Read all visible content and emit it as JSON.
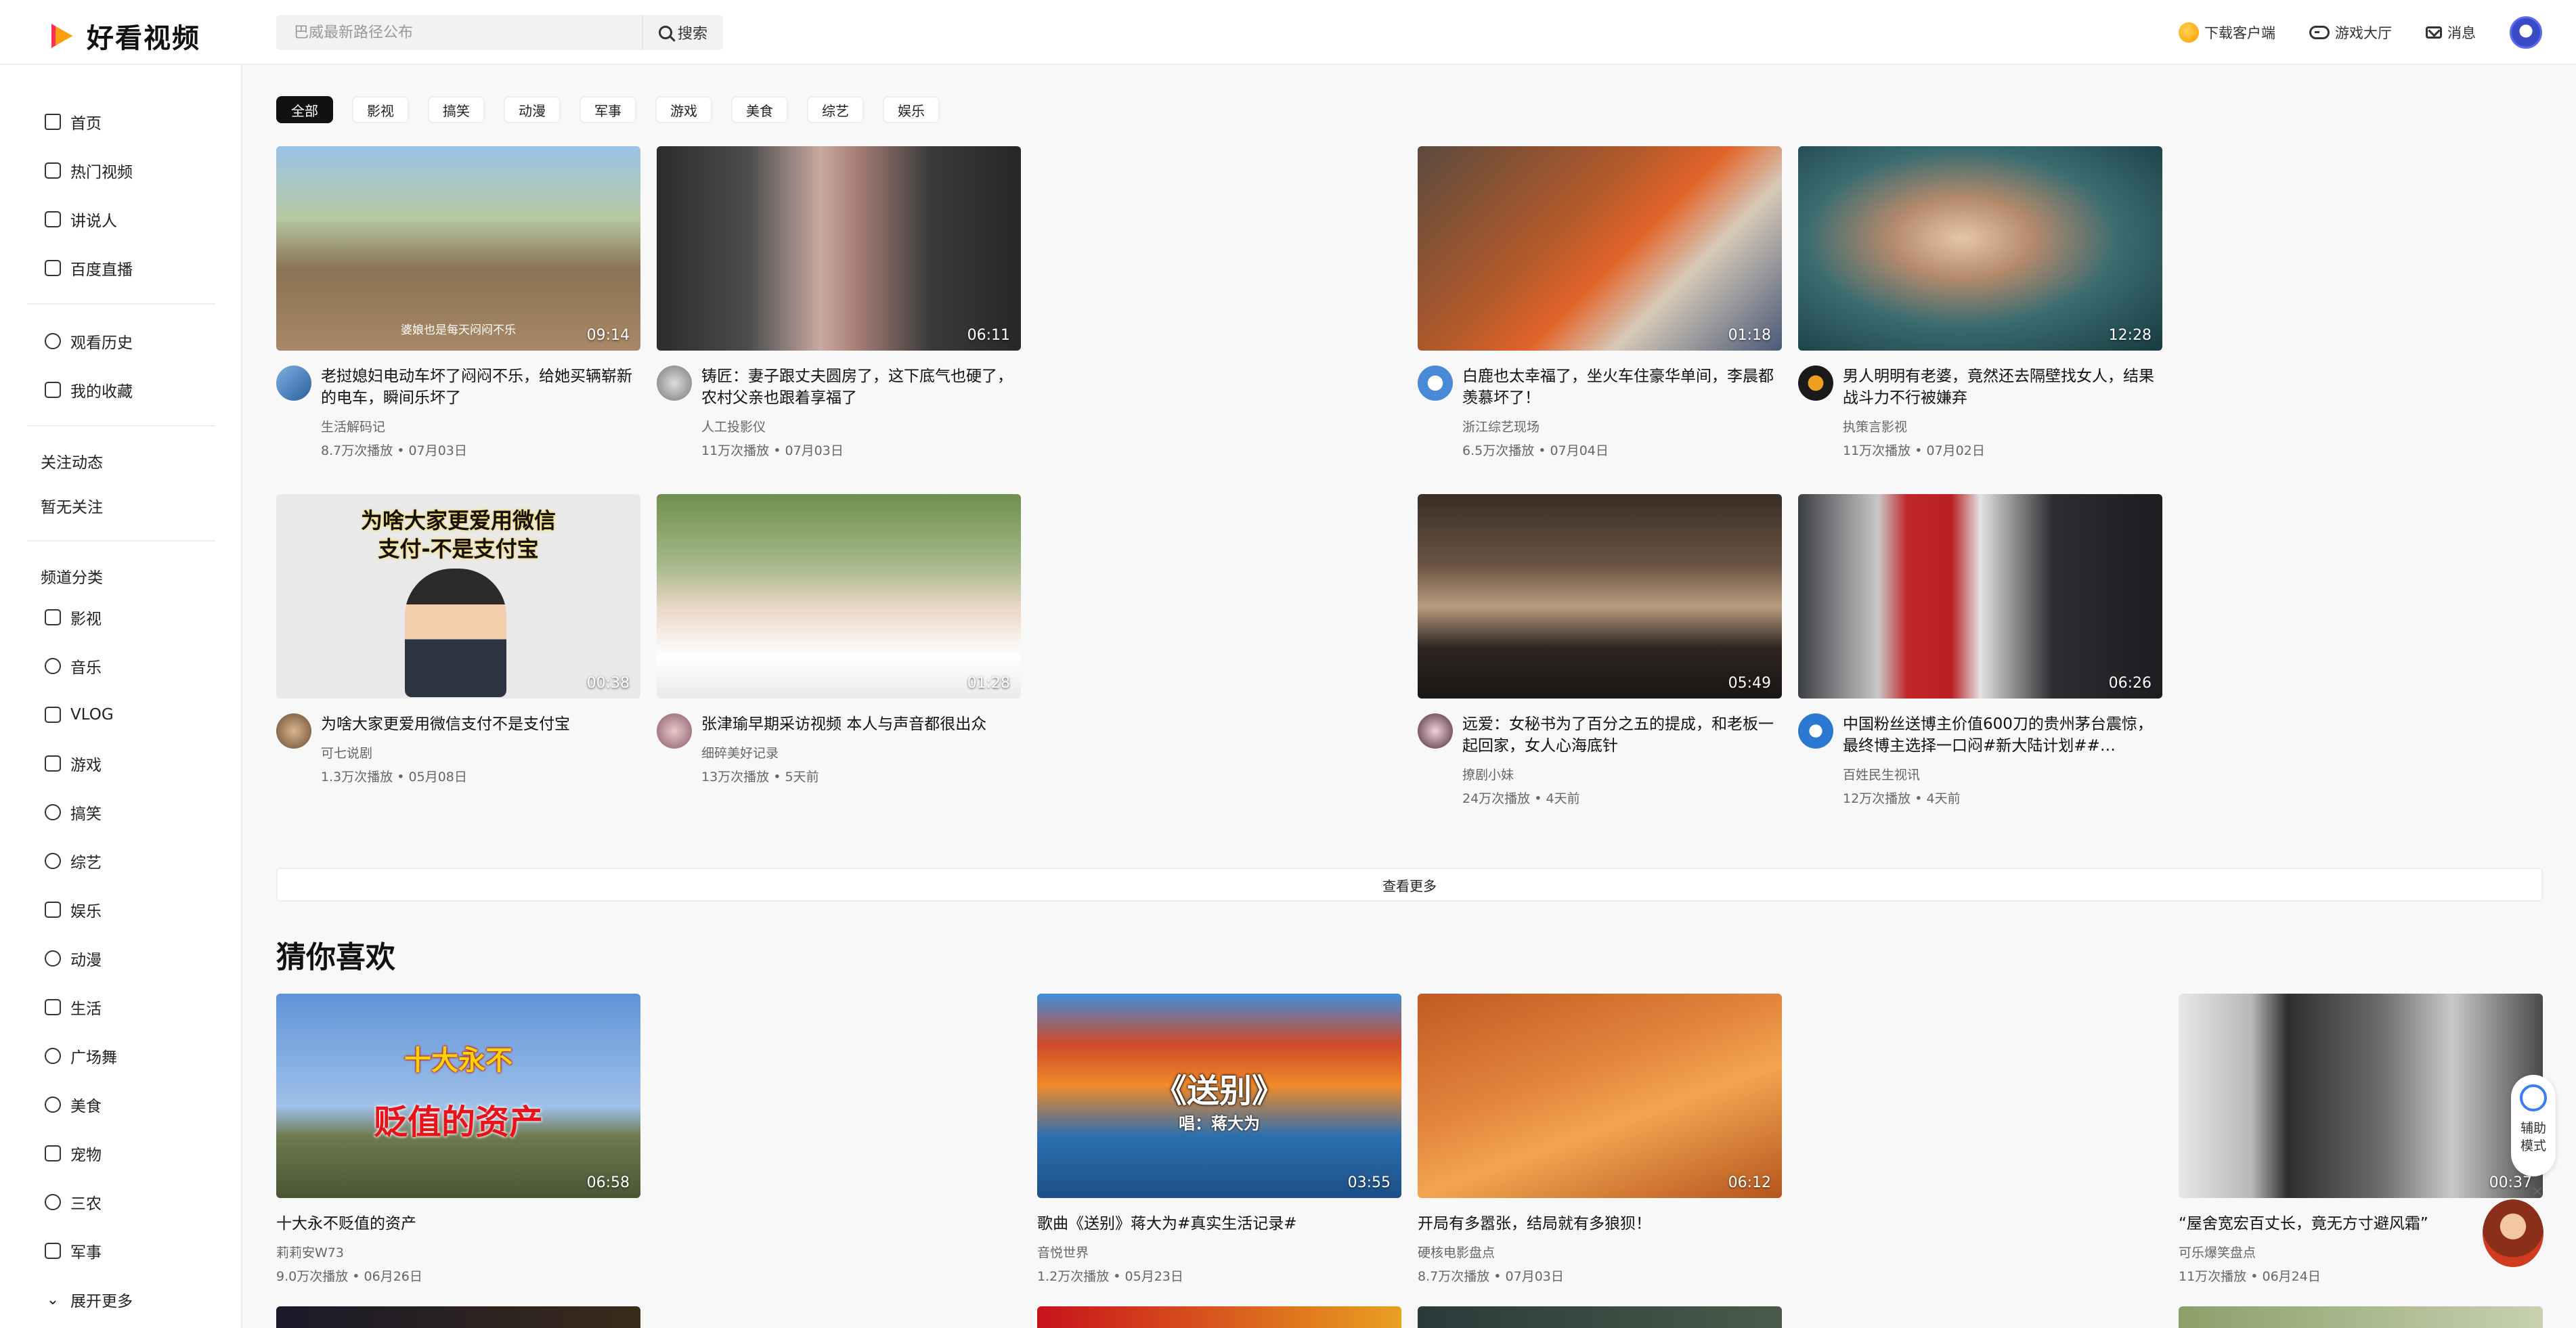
{
  "header": {
    "logo_text": "好看视频",
    "search_placeholder": "巴威最新路径公布",
    "search_button": "搜索",
    "download": "下载客户端",
    "games": "游戏大厅",
    "messages": "消息"
  },
  "sidebar": {
    "main_items": [
      "首页",
      "热门视频",
      "讲说人",
      "百度直播"
    ],
    "user_items": [
      "观看历史",
      "我的收藏"
    ],
    "follow_title": "关注动态",
    "follow_empty": "暂无关注",
    "channel_title": "频道分类",
    "channels": [
      "影视",
      "音乐",
      "VLOG",
      "游戏",
      "搞笑",
      "综艺",
      "娱乐",
      "动漫",
      "生活",
      "广场舞",
      "美食",
      "宠物",
      "三农",
      "军事"
    ],
    "expand_more": "展开更多"
  },
  "chips": [
    "全部",
    "影视",
    "搞笑",
    "动漫",
    "军事",
    "游戏",
    "美食",
    "综艺",
    "娱乐"
  ],
  "feed": [
    {
      "title": "老挝媳妇电动车坏了闷闷不乐，给她买辆崭新的电车，瞬间乐坏了",
      "author": "生活解码记",
      "views": "8.7万次播放",
      "date": "07月03日",
      "duration": "09:14",
      "caption": "婆娘也是每天闷闷不乐"
    },
    {
      "title": "铸匠：妻子跟丈夫圆房了，这下底气也硬了，农村父亲也跟着享福了",
      "author": "人工投影仪",
      "views": "11万次播放",
      "date": "07月03日",
      "duration": "06:11"
    },
    {
      "title": "白鹿也太幸福了，坐火车住豪华单间，李晨都羡慕坏了！",
      "author": "浙江综艺现场",
      "views": "6.5万次播放",
      "date": "07月04日",
      "duration": "01:18"
    },
    {
      "title": "男人明明有老婆，竟然还去隔壁找女人，结果战斗力不行被嫌弃",
      "author": "执策言影视",
      "views": "11万次播放",
      "date": "07月02日",
      "duration": "12:28"
    },
    {
      "title": "为啥大家更爱用微信支付不是支付宝",
      "author": "可七说剧",
      "views": "1.3万次播放",
      "date": "05月08日",
      "duration": "00:38",
      "caption1": "为啥大家更爱用微信",
      "caption2": "支付-不是支付宝"
    },
    {
      "title": "张津瑜早期采访视频 本人与声音都很出众",
      "author": "细碎美好记录",
      "views": "13万次播放",
      "date": "5天前",
      "duration": "01:28"
    },
    {
      "title": "远爱：女秘书为了百分之五的提成，和老板一起回家，女人心海底针",
      "author": "撩剧小妹",
      "views": "24万次播放",
      "date": "4天前",
      "duration": "05:49"
    },
    {
      "title": "中国粉丝送博主价值600刀的贵州茅台震惊，最终博主选择一口闷#新大陆计划##…",
      "author": "百姓民生视讯",
      "views": "12万次播放",
      "date": "4天前",
      "duration": "06:26"
    }
  ],
  "see_more": "查看更多",
  "section_title": "猜你喜欢",
  "recommend": [
    {
      "title": "十大永不贬值的资产",
      "author": "莉莉安W73",
      "views": "9.0万次播放",
      "date": "06月26日",
      "duration": "06:58",
      "caption1": "十大永不",
      "caption2": "贬值的资产"
    },
    {
      "title": "歌曲《送别》蒋大为#真实生活记录#",
      "author": "音悦世界",
      "views": "1.2万次播放",
      "date": "05月23日",
      "duration": "03:55",
      "caption1": "《送别》",
      "caption2": "唱：蒋大为"
    },
    {
      "title": "开局有多嚣张，结局就有多狼狈！",
      "author": "硬核电影盘点",
      "views": "8.7万次播放",
      "date": "07月03日",
      "duration": "06:12"
    },
    {
      "title": "“屋舍宽宏百丈长，竟无方寸避风霜”",
      "author": "可乐爆笑盘点",
      "views": "11万次播放",
      "date": "06月24日",
      "duration": "00:37"
    }
  ],
  "assist": {
    "label": "辅助模式"
  },
  "close_symbol": "×",
  "meta_separator": "•"
}
